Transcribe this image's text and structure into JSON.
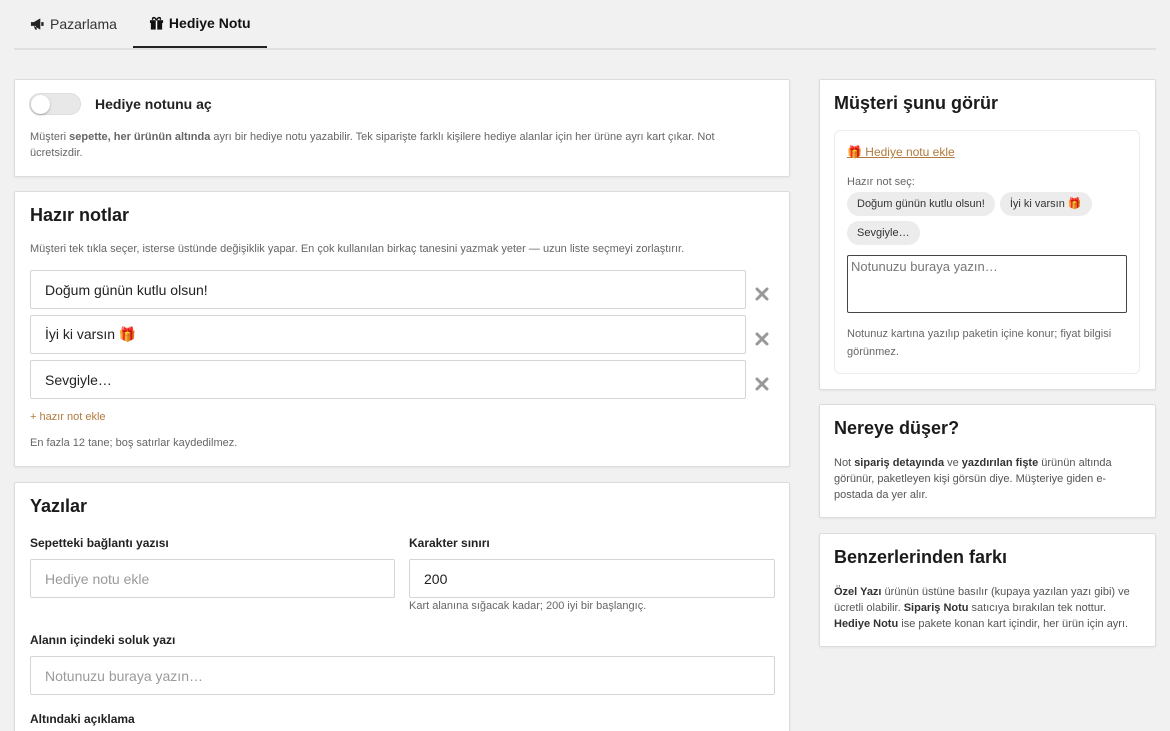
{
  "tabs": [
    {
      "label": "Pazarlama",
      "icon": "megaphone-icon",
      "active": false
    },
    {
      "label": "Hediye Notu",
      "icon": "gift-icon",
      "active": true
    }
  ],
  "toggle": {
    "label": "Hediye notunu aç",
    "enabled": false,
    "desc_pre": "Müşteri ",
    "desc_bold": "sepette, her ürünün altında",
    "desc_post": " ayrı bir hediye notu yazabilir. Tek siparişte farklı kişilere hediye alanlar için her ürüne ayrı kart çıkar. Not ücretsizdir."
  },
  "ready_notes": {
    "title": "Hazır notlar",
    "desc": "Müşteri tek tıkla seçer, isterse üstünde değişiklik yapar. En çok kullanılan birkaç tanesini yazmak yeter — uzun liste seçmeyi zorlaştırır.",
    "items": [
      "Doğum günün kutlu olsun!",
      "İyi ki varsın 🎁",
      "Sevgiyle…"
    ],
    "add_link": "+ hazır not ekle",
    "footer": "En fazla 12 tane; boş satırlar kaydedilmez."
  },
  "texts": {
    "title": "Yazılar",
    "cart_link_label": "Sepetteki bağlantı yazısı",
    "cart_link_placeholder": "Hediye notu ekle",
    "char_limit_label": "Karakter sınırı",
    "char_limit_value": "200",
    "char_limit_help": "Kart alanına sığacak kadar; 200 iyi bir başlangıç.",
    "placeholder_label": "Alanın içindeki soluk yazı",
    "placeholder_value": "Notunuzu buraya yazın…",
    "desc_label": "Altındaki açıklama"
  },
  "preview": {
    "title": "Müşteri şunu görür",
    "link": "🎁 Hediye notu ekle",
    "choose_label": "Hazır not seç:",
    "chips": [
      "Doğum günün kutlu olsun!",
      "İyi ki varsın 🎁",
      "Sevgiyle…"
    ],
    "textarea_placeholder": "Notunuzu buraya yazın…",
    "footnote": "Notunuz kartına yazılıp paketin içine konur; fiyat bilgisi görünmez."
  },
  "where": {
    "title": "Nereye düşer?",
    "t1": "Not ",
    "b1": "sipariş detayında",
    "t2": " ve ",
    "b2": "yazdırılan fişte",
    "t3": " ürünün altında görünür, paketleyen kişi görsün diye. Müşteriye giden e-postada da yer alır."
  },
  "diff": {
    "title": "Benzerlerinden farkı",
    "b1": "Özel Yazı",
    "t1": " ürünün üstüne basılır (kupaya yazılan yazı gibi) ve ücretli olabilir. ",
    "b2": "Sipariş Notu",
    "t2": " satıcıya bırakılan tek nottur. ",
    "b3": "Hediye Notu",
    "t3": " ise pakete konan kart içindir, her ürün için ayrı."
  },
  "colors": {
    "accent": "#b07a3c",
    "background": "#f1f1f1"
  }
}
